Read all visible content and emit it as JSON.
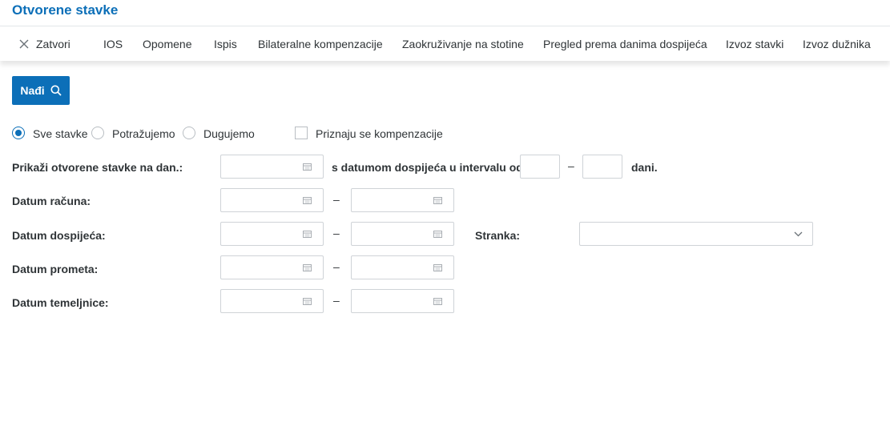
{
  "header": {
    "title": "Otvorene stavke"
  },
  "toolbar": {
    "close_label": "Zatvori",
    "ios_label": "IOS",
    "reminders_label": "Opomene",
    "print_label": "Ispis",
    "bilateral_label": "Bilateralne kompenzacije",
    "rounding_label": "Zaokruživanje na stotine",
    "overview_label": "Pregled prema danima dospijeća",
    "export_items_label": "Izvoz stavki",
    "export_debtor_label": "Izvoz dužnika"
  },
  "search": {
    "button_label": "Nađi",
    "icon": "search-icon"
  },
  "filters": {
    "radio_options": [
      {
        "label": "Sve stavke",
        "checked": true
      },
      {
        "label": "Potražujemo",
        "checked": false
      },
      {
        "label": "Dugujemo",
        "checked": false
      }
    ],
    "compensation_label": "Priznaju se kompenzacije",
    "compensation_checked": false
  },
  "form": {
    "show_on_date_label": "Prikaži otvorene stavke na dan.:",
    "due_interval_label": "s datumom dospijeća u intervalu od",
    "days_label": "dani.",
    "dash": "–",
    "invoice_date_label": "Datum računa:",
    "due_date_label": "Datum dospijeća:",
    "partner_label": "Stranka:",
    "turnover_date_label": "Datum prometa:",
    "journal_date_label": "Datum temeljnice:"
  },
  "colors": {
    "accent": "#0c6fb8",
    "text": "#2f3437",
    "border": "#cfd3d7"
  }
}
